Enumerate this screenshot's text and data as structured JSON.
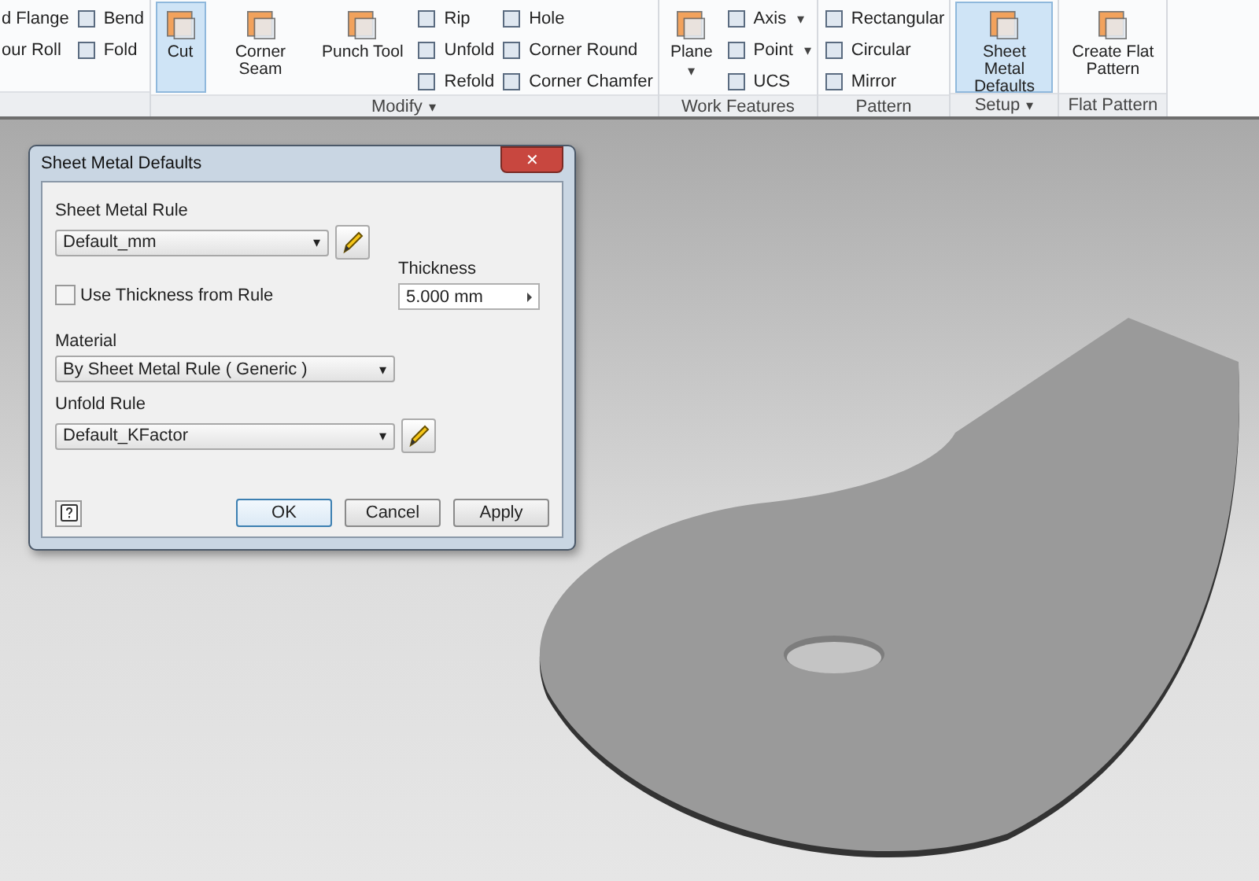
{
  "ribbon": {
    "groups": [
      {
        "columns": [
          {
            "kind": "stack",
            "items": [
              {
                "label": "d Flange"
              },
              {
                "label": "our Roll"
              }
            ]
          },
          {
            "kind": "stack",
            "items": [
              {
                "label": "Bend"
              },
              {
                "label": "Fold"
              }
            ]
          }
        ]
      },
      {
        "label": "Modify",
        "arrow": "▾",
        "columns": [
          {
            "kind": "large",
            "label": "Cut",
            "selected": true
          },
          {
            "kind": "large",
            "label": "Corner Seam",
            "selected": false
          },
          {
            "kind": "large",
            "label": "Punch Tool",
            "selected": false
          },
          {
            "kind": "stack",
            "items": [
              {
                "label": "Rip"
              },
              {
                "label": "Unfold"
              },
              {
                "label": "Refold"
              }
            ]
          },
          {
            "kind": "stack",
            "items": [
              {
                "label": "Hole"
              },
              {
                "label": "Corner Round"
              },
              {
                "label": "Corner Chamfer"
              }
            ]
          }
        ]
      },
      {
        "label": "Work Features",
        "columns": [
          {
            "kind": "large",
            "label": "Plane",
            "selected": false,
            "arrow": "▾"
          },
          {
            "kind": "stack",
            "items": [
              {
                "label": "Axis",
                "arrow": "▾"
              },
              {
                "label": "Point",
                "arrow": "▾"
              },
              {
                "label": "UCS"
              }
            ]
          }
        ]
      },
      {
        "label": "Pattern",
        "columns": [
          {
            "kind": "stack",
            "items": [
              {
                "label": "Rectangular"
              },
              {
                "label": "Circular"
              },
              {
                "label": "Mirror"
              }
            ]
          }
        ]
      },
      {
        "label": "Setup",
        "arrow": "▾",
        "columns": [
          {
            "kind": "large",
            "label": "Sheet Metal Defaults",
            "selected": true
          }
        ]
      },
      {
        "label": "Flat Pattern",
        "columns": [
          {
            "kind": "large",
            "label": "Create Flat Pattern",
            "selected": false
          }
        ]
      }
    ]
  },
  "dialog": {
    "title": "Sheet Metal Defaults",
    "close": "✕",
    "sheet_metal_rule": {
      "label": "Sheet Metal Rule",
      "value": "Default_mm"
    },
    "use_thickness": {
      "label": "Use Thickness from Rule",
      "checked": false
    },
    "thickness": {
      "label": "Thickness",
      "value": "5.000 mm"
    },
    "material": {
      "label": "Material",
      "value": "By Sheet Metal Rule ( Generic )"
    },
    "unfold_rule": {
      "label": "Unfold Rule",
      "value": "Default_KFactor"
    },
    "buttons": [
      {
        "label": "OK",
        "default": true
      },
      {
        "label": "Cancel",
        "default": false
      },
      {
        "label": "Apply",
        "default": false
      }
    ]
  }
}
